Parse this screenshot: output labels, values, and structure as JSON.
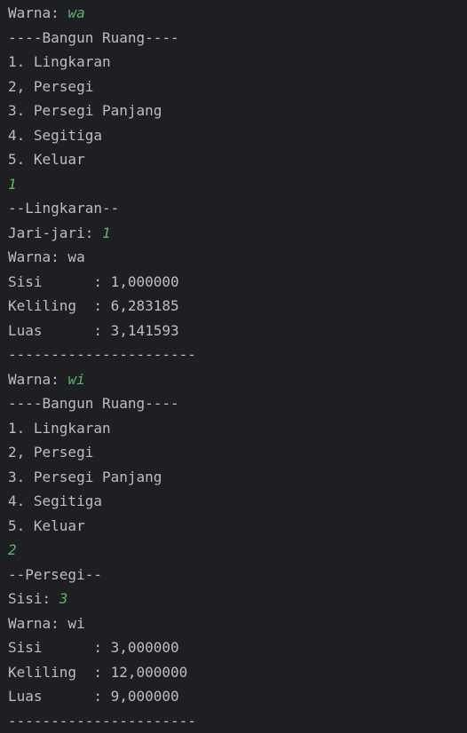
{
  "console": {
    "lines": [
      {
        "text": "Warna: ",
        "input": "wa"
      },
      {
        "text": "----Bangun Ruang----"
      },
      {
        "text": "1. Lingkaran"
      },
      {
        "text": "2, Persegi"
      },
      {
        "text": "3. Persegi Panjang"
      },
      {
        "text": "4. Segitiga"
      },
      {
        "text": "5. Keluar"
      },
      {
        "text": "",
        "input": "1"
      },
      {
        "text": "--Lingkaran--"
      },
      {
        "text": "Jari-jari: ",
        "input": "1"
      },
      {
        "text": "Warna: wa"
      },
      {
        "text": "Sisi      : 1,000000"
      },
      {
        "text": "Keliling  : 6,283185"
      },
      {
        "text": "Luas      : 3,141593"
      },
      {
        "text": "----------------------"
      },
      {
        "text": "Warna: ",
        "input": "wi"
      },
      {
        "text": "----Bangun Ruang----"
      },
      {
        "text": "1. Lingkaran"
      },
      {
        "text": "2, Persegi"
      },
      {
        "text": "3. Persegi Panjang"
      },
      {
        "text": "4. Segitiga"
      },
      {
        "text": "5. Keluar"
      },
      {
        "text": "",
        "input": "2"
      },
      {
        "text": "--Persegi--"
      },
      {
        "text": "Sisi: ",
        "input": "3"
      },
      {
        "text": "Warna: wi"
      },
      {
        "text": "Sisi      : 3,000000"
      },
      {
        "text": "Keliling  : 12,000000"
      },
      {
        "text": "Luas      : 9,000000"
      },
      {
        "text": "----------------------"
      }
    ]
  },
  "colors": {
    "background": "#1e1f22",
    "output_text": "#bcbec4",
    "user_input": "#5fb36b"
  }
}
